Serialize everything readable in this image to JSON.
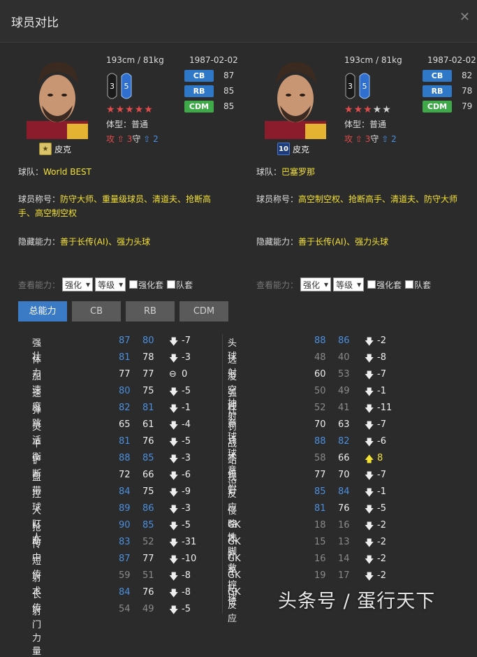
{
  "window": {
    "title": "球员对比"
  },
  "left": {
    "name": "皮克",
    "badge": "★",
    "height_weight": "193cm / 81kg",
    "dob": "1987-02-02",
    "feet": {
      "left": "3",
      "right": "5"
    },
    "positions": [
      {
        "pos": "CB",
        "value": "87",
        "color": "#2f78c8"
      },
      {
        "pos": "RB",
        "value": "85",
        "color": "#2f78c8"
      },
      {
        "pos": "CDM",
        "value": "85",
        "color": "#3fa94a"
      }
    ],
    "stars_total": 5,
    "stars_on": 5,
    "body_label": "体型：",
    "body": "普通",
    "work": {
      "atk_label": "攻",
      "atk": "3",
      "def_label": "守",
      "def": "2"
    },
    "team_label": "球队：",
    "team": "World BEST",
    "traits_label": "球员称号：",
    "traits": "防守大师、重量级球员、清道夫、抢断高手、高空制空权",
    "hidden_label": "隐藏能力：",
    "hidden": "善于长传(AI)、强力头球"
  },
  "right": {
    "name": "皮克",
    "badge": "10",
    "height_weight": "193cm / 81kg",
    "dob": "1987-02-02",
    "feet": {
      "left": "3",
      "right": "5"
    },
    "positions": [
      {
        "pos": "CB",
        "value": "82",
        "color": "#2f78c8"
      },
      {
        "pos": "RB",
        "value": "78",
        "color": "#2f78c8"
      },
      {
        "pos": "CDM",
        "value": "79",
        "color": "#3fa94a"
      }
    ],
    "stars_total": 5,
    "stars_on": 3,
    "body_label": "体型：",
    "body": "普通",
    "work": {
      "atk_label": "攻",
      "atk": "3",
      "def_label": "守",
      "def": "2"
    },
    "team_label": "球队：",
    "team": "巴塞罗那",
    "traits_label": "球员称号：",
    "traits": "高空制空权、抢断高手、清道夫、防守大师",
    "hidden_label": "隐藏能力：",
    "hidden": "善于长传(AI)、强力头球"
  },
  "view_controls": {
    "label": "查看能力：",
    "select1": "强化",
    "select2": "等级",
    "check1": "强化套",
    "check2": "队套"
  },
  "tabs": [
    "总能力",
    "CB",
    "RB",
    "CDM"
  ],
  "colors": {
    "blue": "#4a8fe0",
    "gray": "#8a8a8a",
    "white": "#eeeeee",
    "up": "#f4e135"
  },
  "stats_left": [
    {
      "name": "强壮",
      "a": "87",
      "b": "80",
      "ca": "blue",
      "cb": "blue",
      "dir": "down",
      "diff": "-7"
    },
    {
      "name": "体力",
      "a": "81",
      "b": "78",
      "ca": "blue",
      "cb": "white",
      "dir": "down",
      "diff": "-3"
    },
    {
      "name": "加速",
      "a": "77",
      "b": "77",
      "ca": "white",
      "cb": "white",
      "dir": "eq",
      "diff": "0"
    },
    {
      "name": "速度",
      "a": "80",
      "b": "75",
      "ca": "blue",
      "cb": "white",
      "dir": "down",
      "diff": "-5"
    },
    {
      "name": "弹跳",
      "a": "82",
      "b": "81",
      "ca": "blue",
      "cb": "blue",
      "dir": "down",
      "diff": "-1"
    },
    {
      "name": "灵活",
      "a": "65",
      "b": "61",
      "ca": "white",
      "cb": "white",
      "dir": "down",
      "diff": "-4"
    },
    {
      "name": "平衡",
      "a": "81",
      "b": "76",
      "ca": "blue",
      "cb": "white",
      "dir": "down",
      "diff": "-5"
    },
    {
      "name": "铲断",
      "a": "88",
      "b": "85",
      "ca": "blue",
      "cb": "blue",
      "dir": "down",
      "diff": "-3"
    },
    {
      "name": "盘带",
      "a": "72",
      "b": "66",
      "ca": "white",
      "cb": "white",
      "dir": "down",
      "diff": "-6"
    },
    {
      "name": "控球",
      "a": "84",
      "b": "75",
      "ca": "blue",
      "cb": "white",
      "dir": "down",
      "diff": "-9"
    },
    {
      "name": "人盯人",
      "a": "89",
      "b": "86",
      "ca": "blue",
      "cb": "blue",
      "dir": "down",
      "diff": "-3"
    },
    {
      "name": "抢断",
      "a": "90",
      "b": "85",
      "ca": "blue",
      "cb": "blue",
      "dir": "down",
      "diff": "-5"
    },
    {
      "name": "传中",
      "a": "83",
      "b": "52",
      "ca": "blue",
      "cb": "gray",
      "dir": "down",
      "diff": "-31"
    },
    {
      "name": "短传",
      "a": "87",
      "b": "77",
      "ca": "blue",
      "cb": "white",
      "dir": "down",
      "diff": "-10"
    },
    {
      "name": "射术",
      "a": "59",
      "b": "51",
      "ca": "gray",
      "cb": "gray",
      "dir": "down",
      "diff": "-8"
    },
    {
      "name": "长传",
      "a": "84",
      "b": "76",
      "ca": "blue",
      "cb": "white",
      "dir": "down",
      "diff": "-8"
    },
    {
      "name": "射门力量",
      "a": "54",
      "b": "49",
      "ca": "gray",
      "cb": "gray",
      "dir": "down",
      "diff": "-5"
    }
  ],
  "stats_right": [
    {
      "name": "头球",
      "a": "88",
      "b": "86",
      "ca": "blue",
      "cb": "blue",
      "dir": "down",
      "diff": "-2"
    },
    {
      "name": "远射",
      "a": "48",
      "b": "40",
      "ca": "gray",
      "cb": "gray",
      "dir": "down",
      "diff": "-8"
    },
    {
      "name": "凌空抽射",
      "a": "60",
      "b": "53",
      "ca": "white",
      "cb": "gray",
      "dir": "down",
      "diff": "-7"
    },
    {
      "name": "弧线",
      "a": "50",
      "b": "49",
      "ca": "gray",
      "cb": "gray",
      "dir": "down",
      "diff": "-1"
    },
    {
      "name": "任意球",
      "a": "52",
      "b": "41",
      "ca": "gray",
      "cb": "gray",
      "dir": "down",
      "diff": "-11"
    },
    {
      "name": "罚点球",
      "a": "70",
      "b": "63",
      "ca": "white",
      "cb": "white",
      "dir": "down",
      "diff": "-7"
    },
    {
      "name": "战术意识",
      "a": "88",
      "b": "82",
      "ca": "blue",
      "cb": "blue",
      "dir": "down",
      "diff": "-6"
    },
    {
      "name": "站位",
      "a": "58",
      "b": "66",
      "ca": "gray",
      "cb": "white",
      "dir": "up",
      "diff": "8"
    },
    {
      "name": "视野",
      "a": "77",
      "b": "70",
      "ca": "white",
      "cb": "white",
      "dir": "down",
      "diff": "-7"
    },
    {
      "name": "反应",
      "a": "85",
      "b": "84",
      "ca": "blue",
      "cb": "blue",
      "dir": "down",
      "diff": "-1"
    },
    {
      "name": "侵略性",
      "a": "81",
      "b": "76",
      "ca": "blue",
      "cb": "white",
      "dir": "down",
      "diff": "-5"
    },
    {
      "name": "GK大脚",
      "a": "18",
      "b": "16",
      "ca": "gray",
      "cb": "gray",
      "dir": "down",
      "diff": "-2"
    },
    {
      "name": "GK扑救",
      "a": "15",
      "b": "13",
      "ca": "gray",
      "cb": "gray",
      "dir": "down",
      "diff": "-2"
    },
    {
      "name": "GK手控球",
      "a": "16",
      "b": "14",
      "ca": "gray",
      "cb": "gray",
      "dir": "down",
      "diff": "-2"
    },
    {
      "name": "GK站位",
      "a": "19",
      "b": "17",
      "ca": "gray",
      "cb": "gray",
      "dir": "down",
      "diff": "-2"
    },
    {
      "name": "GK反应",
      "a": "",
      "b": "",
      "ca": "gray",
      "cb": "gray",
      "dir": "",
      "diff": ""
    }
  ],
  "watermark": "头条号 / 蛋行天下"
}
